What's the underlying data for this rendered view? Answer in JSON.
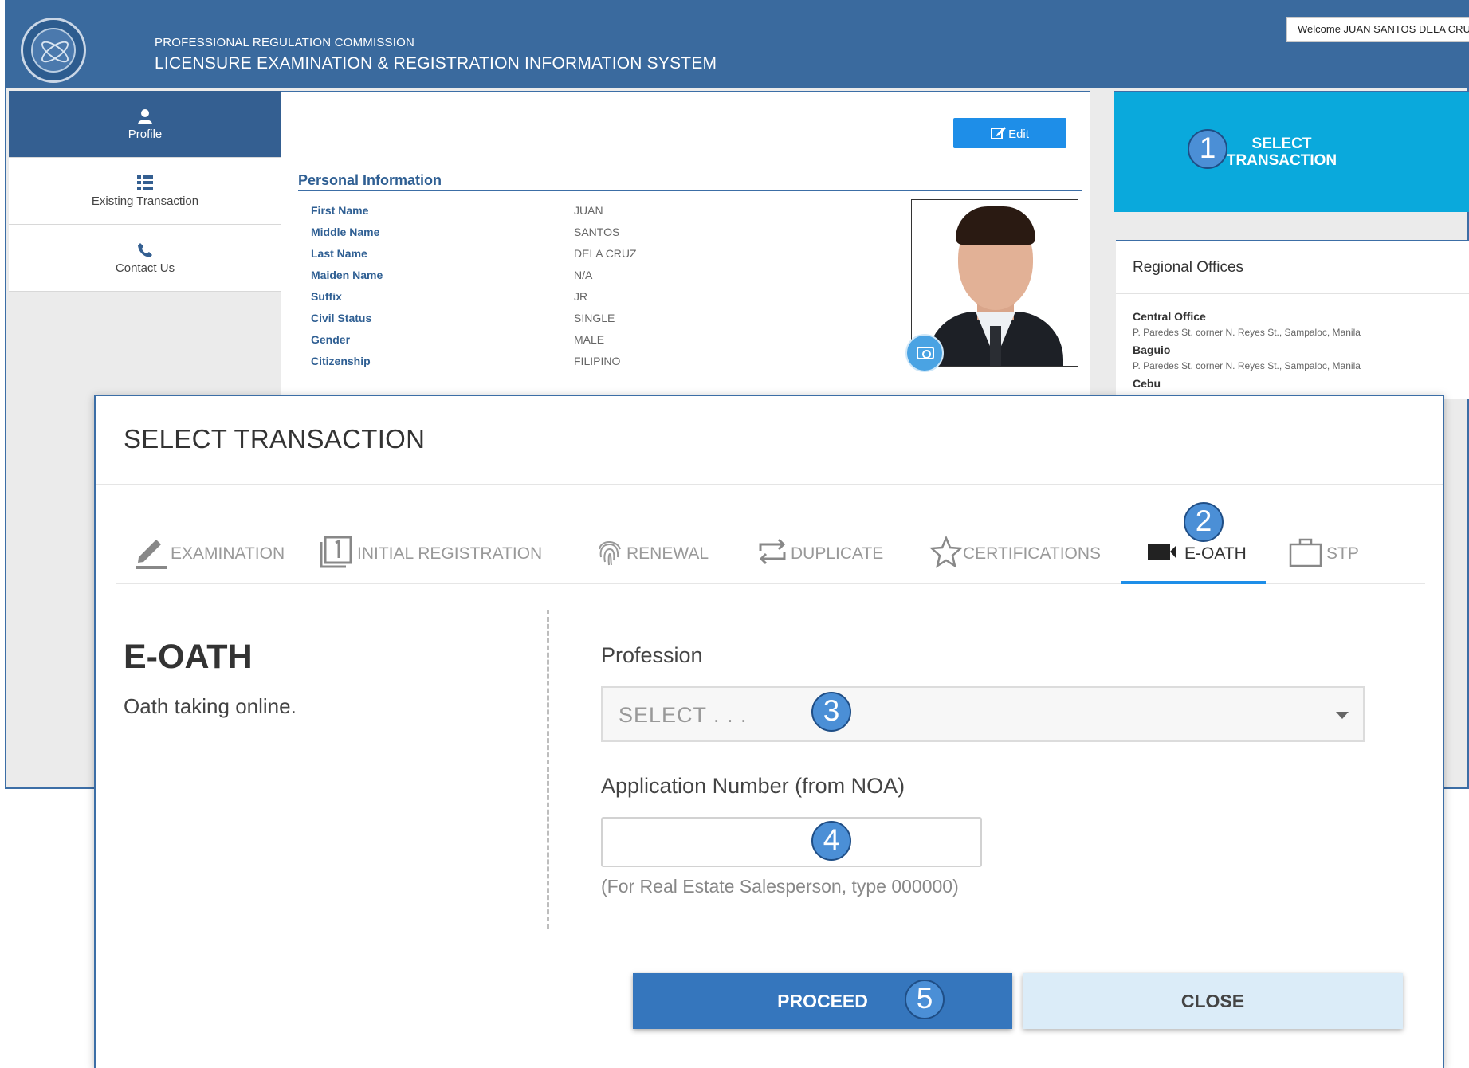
{
  "header": {
    "org_name": "PROFESSIONAL REGULATION COMMISSION",
    "system_name": "LICENSURE EXAMINATION & REGISTRATION INFORMATION SYSTEM",
    "welcome": "Welcome JUAN SANTOS DELA CRUZ"
  },
  "sidebar": {
    "items": [
      {
        "label": "Profile",
        "icon": "user-icon",
        "active": true
      },
      {
        "label": "Existing Transaction",
        "icon": "list-icon",
        "active": false
      },
      {
        "label": "Contact Us",
        "icon": "phone-icon",
        "active": false
      }
    ]
  },
  "profile": {
    "edit_label": "Edit",
    "section_title": "Personal Information",
    "fields": [
      {
        "label": "First Name",
        "value": "JUAN"
      },
      {
        "label": "Middle Name",
        "value": "SANTOS"
      },
      {
        "label": "Last Name",
        "value": "DELA CRUZ"
      },
      {
        "label": "Maiden Name",
        "value": "N/A"
      },
      {
        "label": "Suffix",
        "value": "JR"
      },
      {
        "label": "Civil Status",
        "value": "SINGLE"
      },
      {
        "label": "Gender",
        "value": "MALE"
      },
      {
        "label": "Citizenship",
        "value": "FILIPINO"
      }
    ]
  },
  "select_tile": {
    "line1": "SELECT",
    "line2": "TRANSACTION"
  },
  "regional": {
    "title": "Regional Offices",
    "offices": [
      {
        "name": "Central Office",
        "address": "P. Paredes St. corner N. Reyes St., Sampaloc, Manila"
      },
      {
        "name": "Baguio",
        "address": "P. Paredes St. corner N. Reyes St., Sampaloc, Manila"
      },
      {
        "name": "Cebu",
        "address": ""
      }
    ]
  },
  "markers": [
    "1",
    "2",
    "3",
    "4",
    "5"
  ],
  "modal": {
    "title": "SELECT TRANSACTION",
    "tabs": [
      {
        "label": "EXAMINATION",
        "icon": "pencil-icon"
      },
      {
        "label": "INITIAL REGISTRATION",
        "icon": "number-one-icon"
      },
      {
        "label": "RENEWAL",
        "icon": "fingerprint-icon"
      },
      {
        "label": "DUPLICATE",
        "icon": "repeat-icon"
      },
      {
        "label": "CERTIFICATIONS",
        "icon": "star-icon"
      },
      {
        "label": "E-OATH",
        "icon": "video-camera-icon",
        "active": true
      },
      {
        "label": "STP",
        "icon": "briefcase-icon"
      }
    ],
    "pane_title": "E-OATH",
    "pane_desc": "Oath taking online.",
    "profession_label": "Profession",
    "profession_value": "SELECT . . .",
    "appno_label": "Application Number (from NOA)",
    "appno_value": "",
    "appno_hint": "(For Real Estate Salesperson, type 000000)",
    "proceed_label": "PROCEED",
    "close_label": "CLOSE"
  },
  "colors": {
    "header_bg": "#3a6a9e",
    "sidebar_active": "#345f91",
    "tile_bg": "#0aa9dc",
    "accent": "#1e8ee8",
    "proceed_bg": "#3576bd",
    "close_bg": "#dbecf8",
    "marker_bg": "#4b8fd6"
  }
}
